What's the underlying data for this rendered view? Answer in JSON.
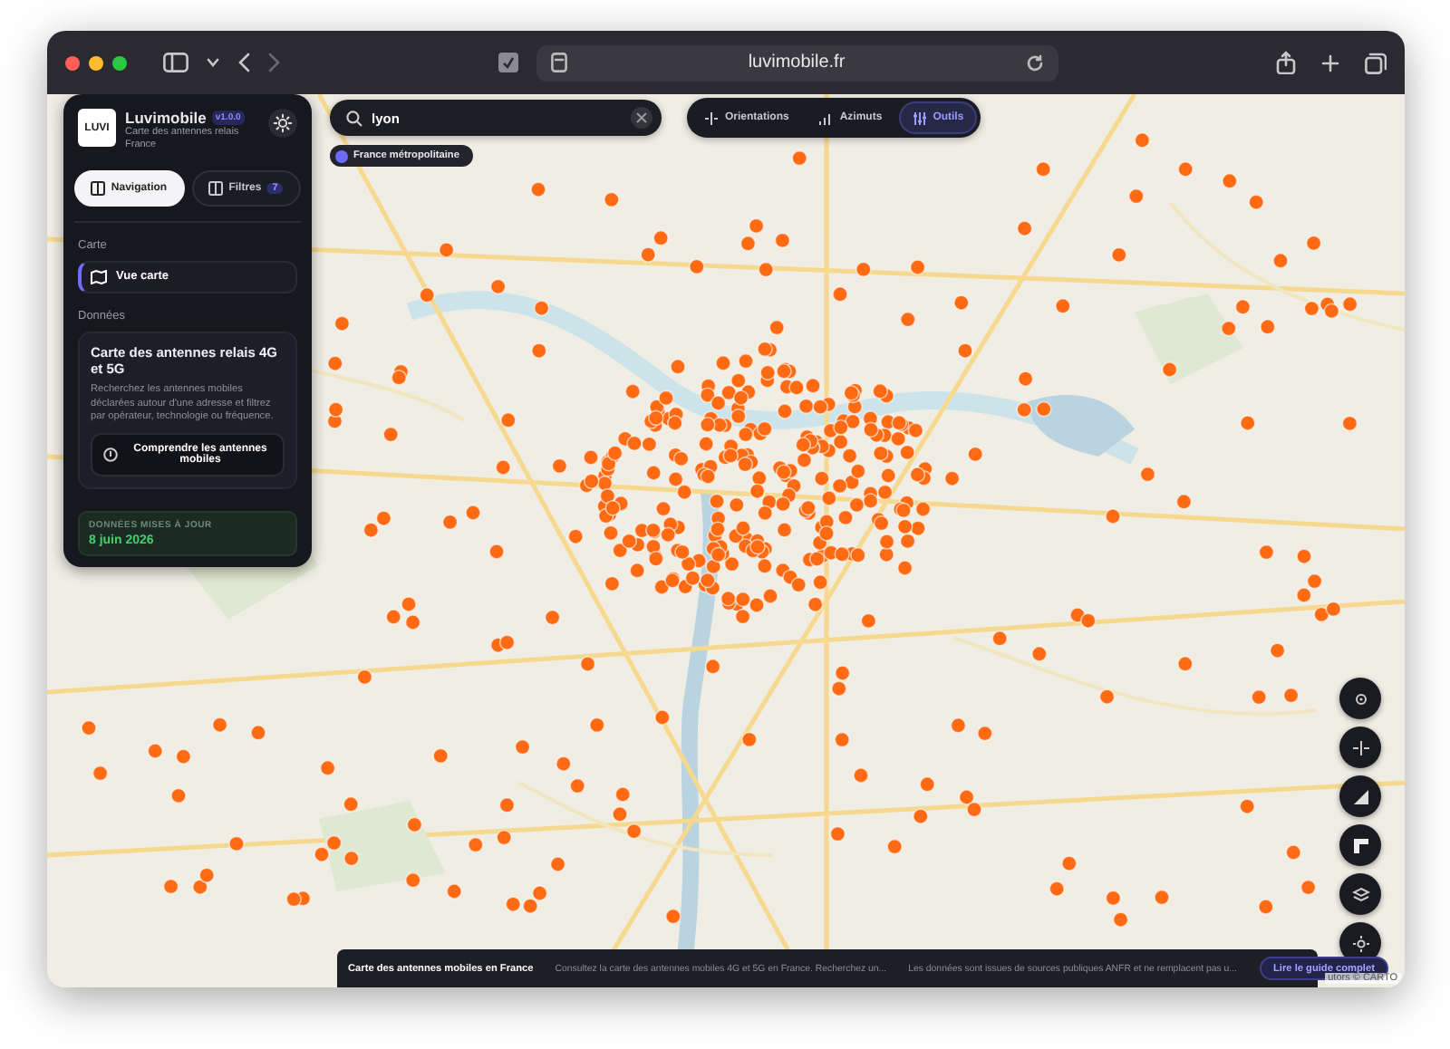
{
  "browser": {
    "url": "luvimobile.fr"
  },
  "sidebar": {
    "app_name": "Luvimobile",
    "version": "v1.0.0",
    "subtitle": "Carte des antennes relais France",
    "logo_text": "LUVI",
    "tabs": [
      {
        "label": "Navigation",
        "selected": true
      },
      {
        "label": "Filtres",
        "badge": "7",
        "selected": false
      }
    ],
    "carte_heading": "Carte",
    "items": [
      {
        "label": "Vue carte",
        "selected": true
      }
    ],
    "donnees_heading": "Données",
    "card": {
      "title": "Carte des antennes relais 4G et 5G",
      "description": "Recherchez les antennes mobiles déclarées autour d'une adresse et filtrez par opérateur, technologie ou fréquence.",
      "button": "Comprendre les antennes mobiles"
    },
    "update": {
      "label": "DONNÉES MISES À JOUR",
      "date": "8 juin 2026"
    }
  },
  "search": {
    "value": "lyon"
  },
  "region_chip": {
    "label": "France métropolitaine"
  },
  "tools": [
    {
      "label": "Orientations",
      "kind": "orientations",
      "selected": false
    },
    {
      "label": "Azimuts",
      "kind": "azimuts",
      "selected": false
    },
    {
      "label": "Outils",
      "kind": "outils",
      "selected": true
    }
  ],
  "map_controls": [
    {
      "kind": "locate"
    },
    {
      "kind": "orientations"
    },
    {
      "kind": "signal"
    },
    {
      "kind": "corner"
    },
    {
      "kind": "layers"
    },
    {
      "kind": "theme"
    }
  ],
  "bottom_bar": {
    "title": "Carte des antennes mobiles en France",
    "items": [
      "Consultez la carte des antennes mobiles 4G et 5G en France. Recherchez un...",
      "Les données sont issues de sources publiques ANFR et ne remplacent pas u..."
    ],
    "link": "Lire le guide complet"
  },
  "attribution": "utors © CARTO"
}
